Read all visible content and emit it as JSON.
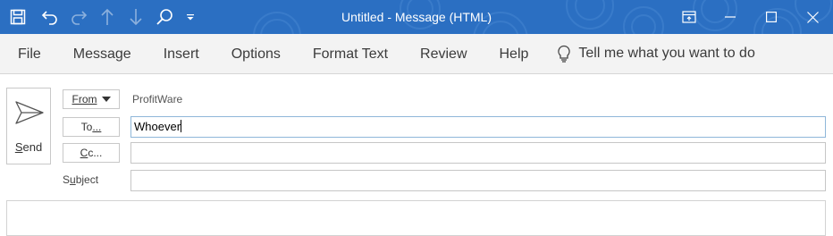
{
  "window": {
    "title": "Untitled  -  Message (HTML)"
  },
  "quick_access": {
    "icons": [
      "save-icon",
      "undo-icon",
      "redo-icon",
      "previous-item-icon",
      "next-item-icon",
      "search-icon",
      "customize-qat-icon"
    ]
  },
  "window_controls": {
    "icons": [
      "ribbon-display-options-icon",
      "minimize-icon",
      "maximize-icon",
      "close-icon"
    ]
  },
  "menu": {
    "items": [
      {
        "label": "File"
      },
      {
        "label": "Message"
      },
      {
        "label": "Insert"
      },
      {
        "label": "Options"
      },
      {
        "label": "Format Text"
      },
      {
        "label": "Review"
      },
      {
        "label": "Help"
      }
    ],
    "tell_me": "Tell me what you want to do"
  },
  "compose": {
    "send": {
      "underlined": "S",
      "rest": "end"
    },
    "from": {
      "underlined": "From",
      "caret": "▼",
      "value": "ProfitWare"
    },
    "to": {
      "pre": "To",
      "underlined": "...",
      "value": "Whoever"
    },
    "cc": {
      "underlined": "C",
      "rest": "c...",
      "value": ""
    },
    "subject": {
      "pre": "S",
      "underlined": "u",
      "rest": "bject",
      "value": ""
    }
  },
  "colors": {
    "titlebar": "#2b6fc2",
    "menubar": "#f3f3f3",
    "focus_border": "#8fb7d9"
  }
}
